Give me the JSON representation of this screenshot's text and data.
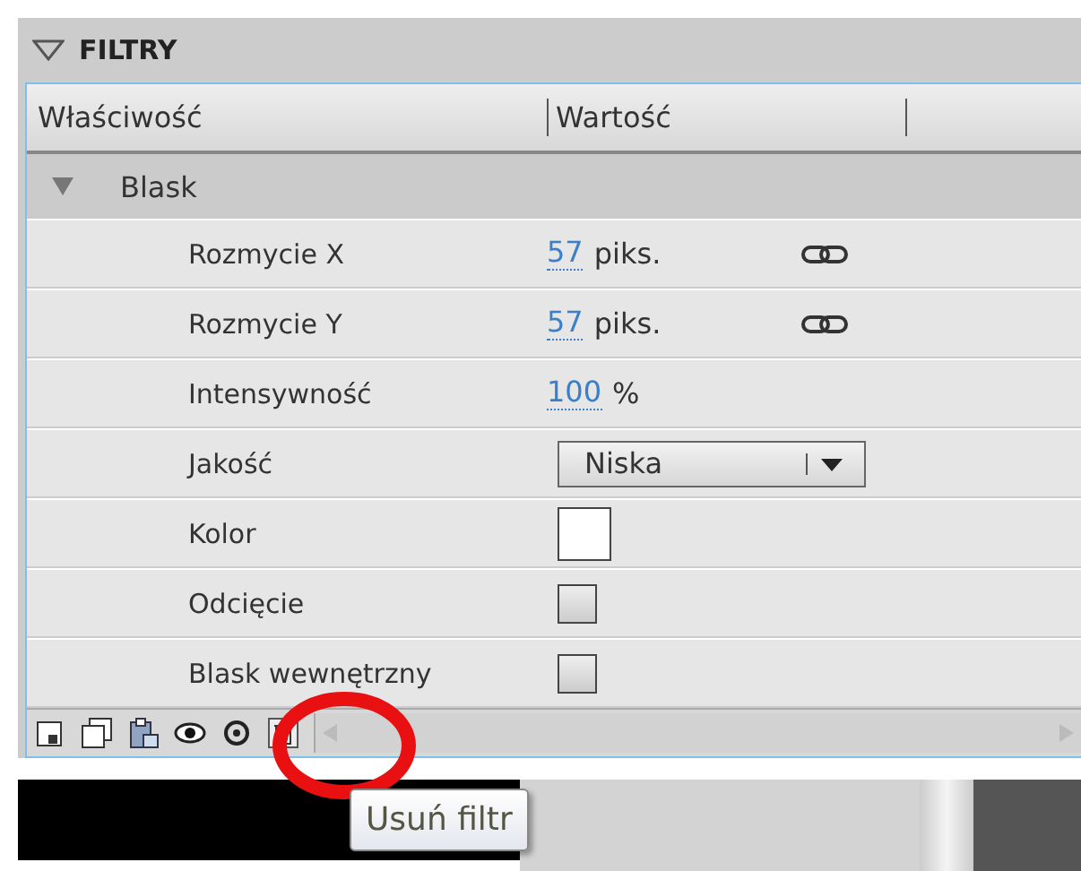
{
  "panel": {
    "title": "FILTRY",
    "expanded": true
  },
  "columns": [
    "Właściwość",
    "Wartość"
  ],
  "filter": {
    "name": "Blask",
    "expanded": true
  },
  "properties": [
    {
      "kind": "number",
      "label": "Rozmycie X",
      "value": "57",
      "unit": "piks.",
      "linked": true
    },
    {
      "kind": "number",
      "label": "Rozmycie Y",
      "value": "57",
      "unit": "piks.",
      "linked": true
    },
    {
      "kind": "number",
      "label": "Intensywność",
      "value": "100",
      "unit": "%",
      "linked": false
    },
    {
      "kind": "dropdown",
      "label": "Jakość",
      "value": "Niska"
    },
    {
      "kind": "color",
      "label": "Kolor",
      "color": "#ffffff"
    },
    {
      "kind": "checkbox",
      "label": "Odcięcie",
      "checked": false
    },
    {
      "kind": "checkbox",
      "label": "Blask wewnętrzny",
      "checked": false
    }
  ],
  "tooltip": "Usuń filtr"
}
